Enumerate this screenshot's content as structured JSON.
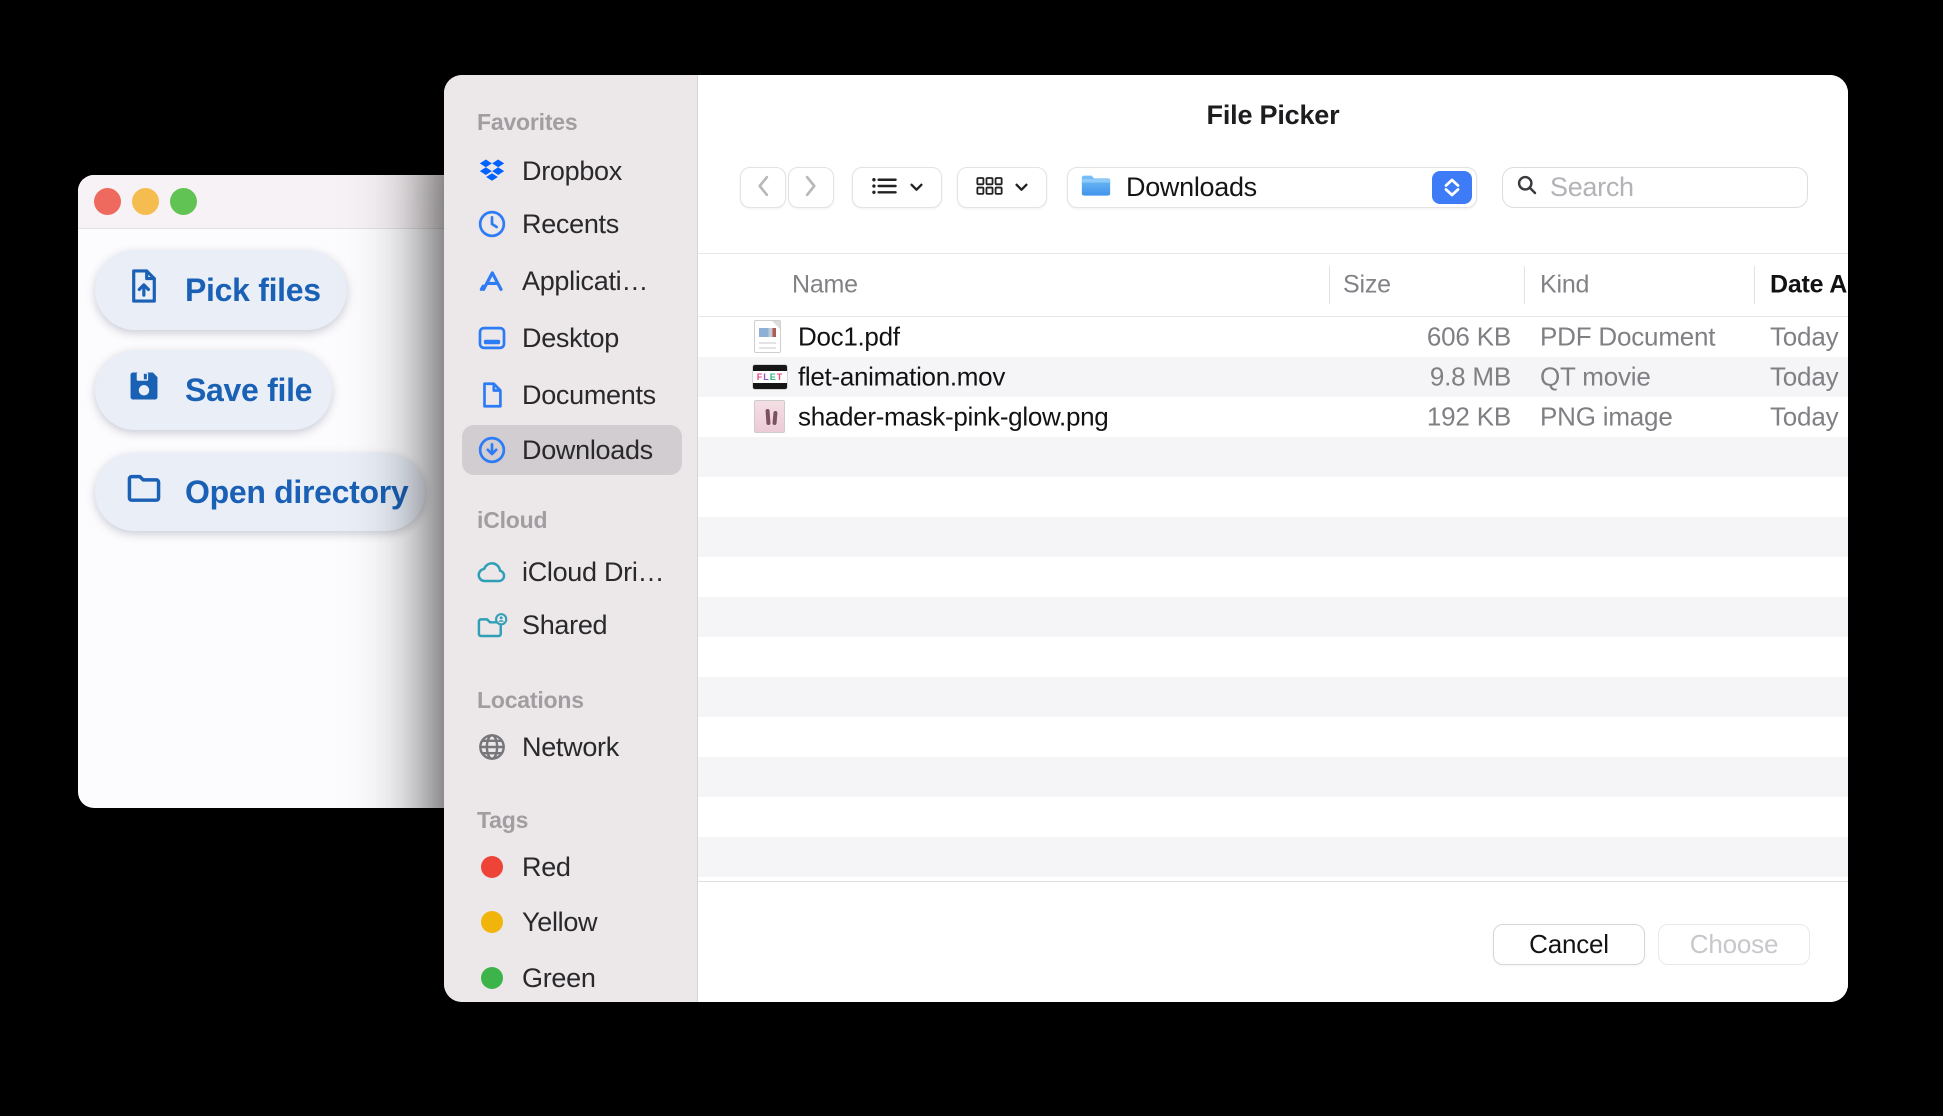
{
  "colors": {
    "accent_blue": "#1a61b6",
    "system_blue": "#2e7cf5",
    "dropbox_blue": "#0062ff",
    "icloud_teal": "#2f9fb8",
    "tag_red": "#ee4437",
    "tag_yellow": "#f0b40a",
    "tag_green": "#3db449",
    "sidebar_bg": "#ece7e9",
    "selection_gray": "#d2cdd0",
    "popup_button_blue": "#3d7bf7"
  },
  "app_window": {
    "buttons": [
      {
        "label": "Pick files"
      },
      {
        "label": "Save file"
      },
      {
        "label": "Open directory"
      }
    ]
  },
  "dialog": {
    "title": "File Picker",
    "toolbar": {
      "path_label": "Downloads",
      "search_placeholder": "Search"
    },
    "sidebar": {
      "sections": [
        {
          "title": "Favorites",
          "items": [
            {
              "label": "Dropbox"
            },
            {
              "label": "Recents"
            },
            {
              "label": "Applicati…"
            },
            {
              "label": "Desktop"
            },
            {
              "label": "Documents"
            },
            {
              "label": "Downloads",
              "selected": true
            }
          ]
        },
        {
          "title": "iCloud",
          "items": [
            {
              "label": "iCloud Dri…"
            },
            {
              "label": "Shared"
            }
          ]
        },
        {
          "title": "Locations",
          "items": [
            {
              "label": "Network"
            }
          ]
        },
        {
          "title": "Tags",
          "items": [
            {
              "label": "Red"
            },
            {
              "label": "Yellow"
            },
            {
              "label": "Green"
            }
          ]
        }
      ]
    },
    "table": {
      "columns": [
        "Name",
        "Size",
        "Kind",
        "Date Added"
      ],
      "files": [
        {
          "name": "Doc1.pdf",
          "size": "606 KB",
          "kind": "PDF Document",
          "date_added": "Today"
        },
        {
          "name": "flet-animation.mov",
          "size": "9.8 MB",
          "kind": "QT movie",
          "date_added": "Today"
        },
        {
          "name": "shader-mask-pink-glow.png",
          "size": "192 KB",
          "kind": "PNG image",
          "date_added": "Today"
        }
      ]
    },
    "movie_icon_letters": [
      "F",
      "L",
      "E",
      "T"
    ],
    "footer": {
      "cancel_label": "Cancel",
      "choose_label": "Choose"
    }
  }
}
